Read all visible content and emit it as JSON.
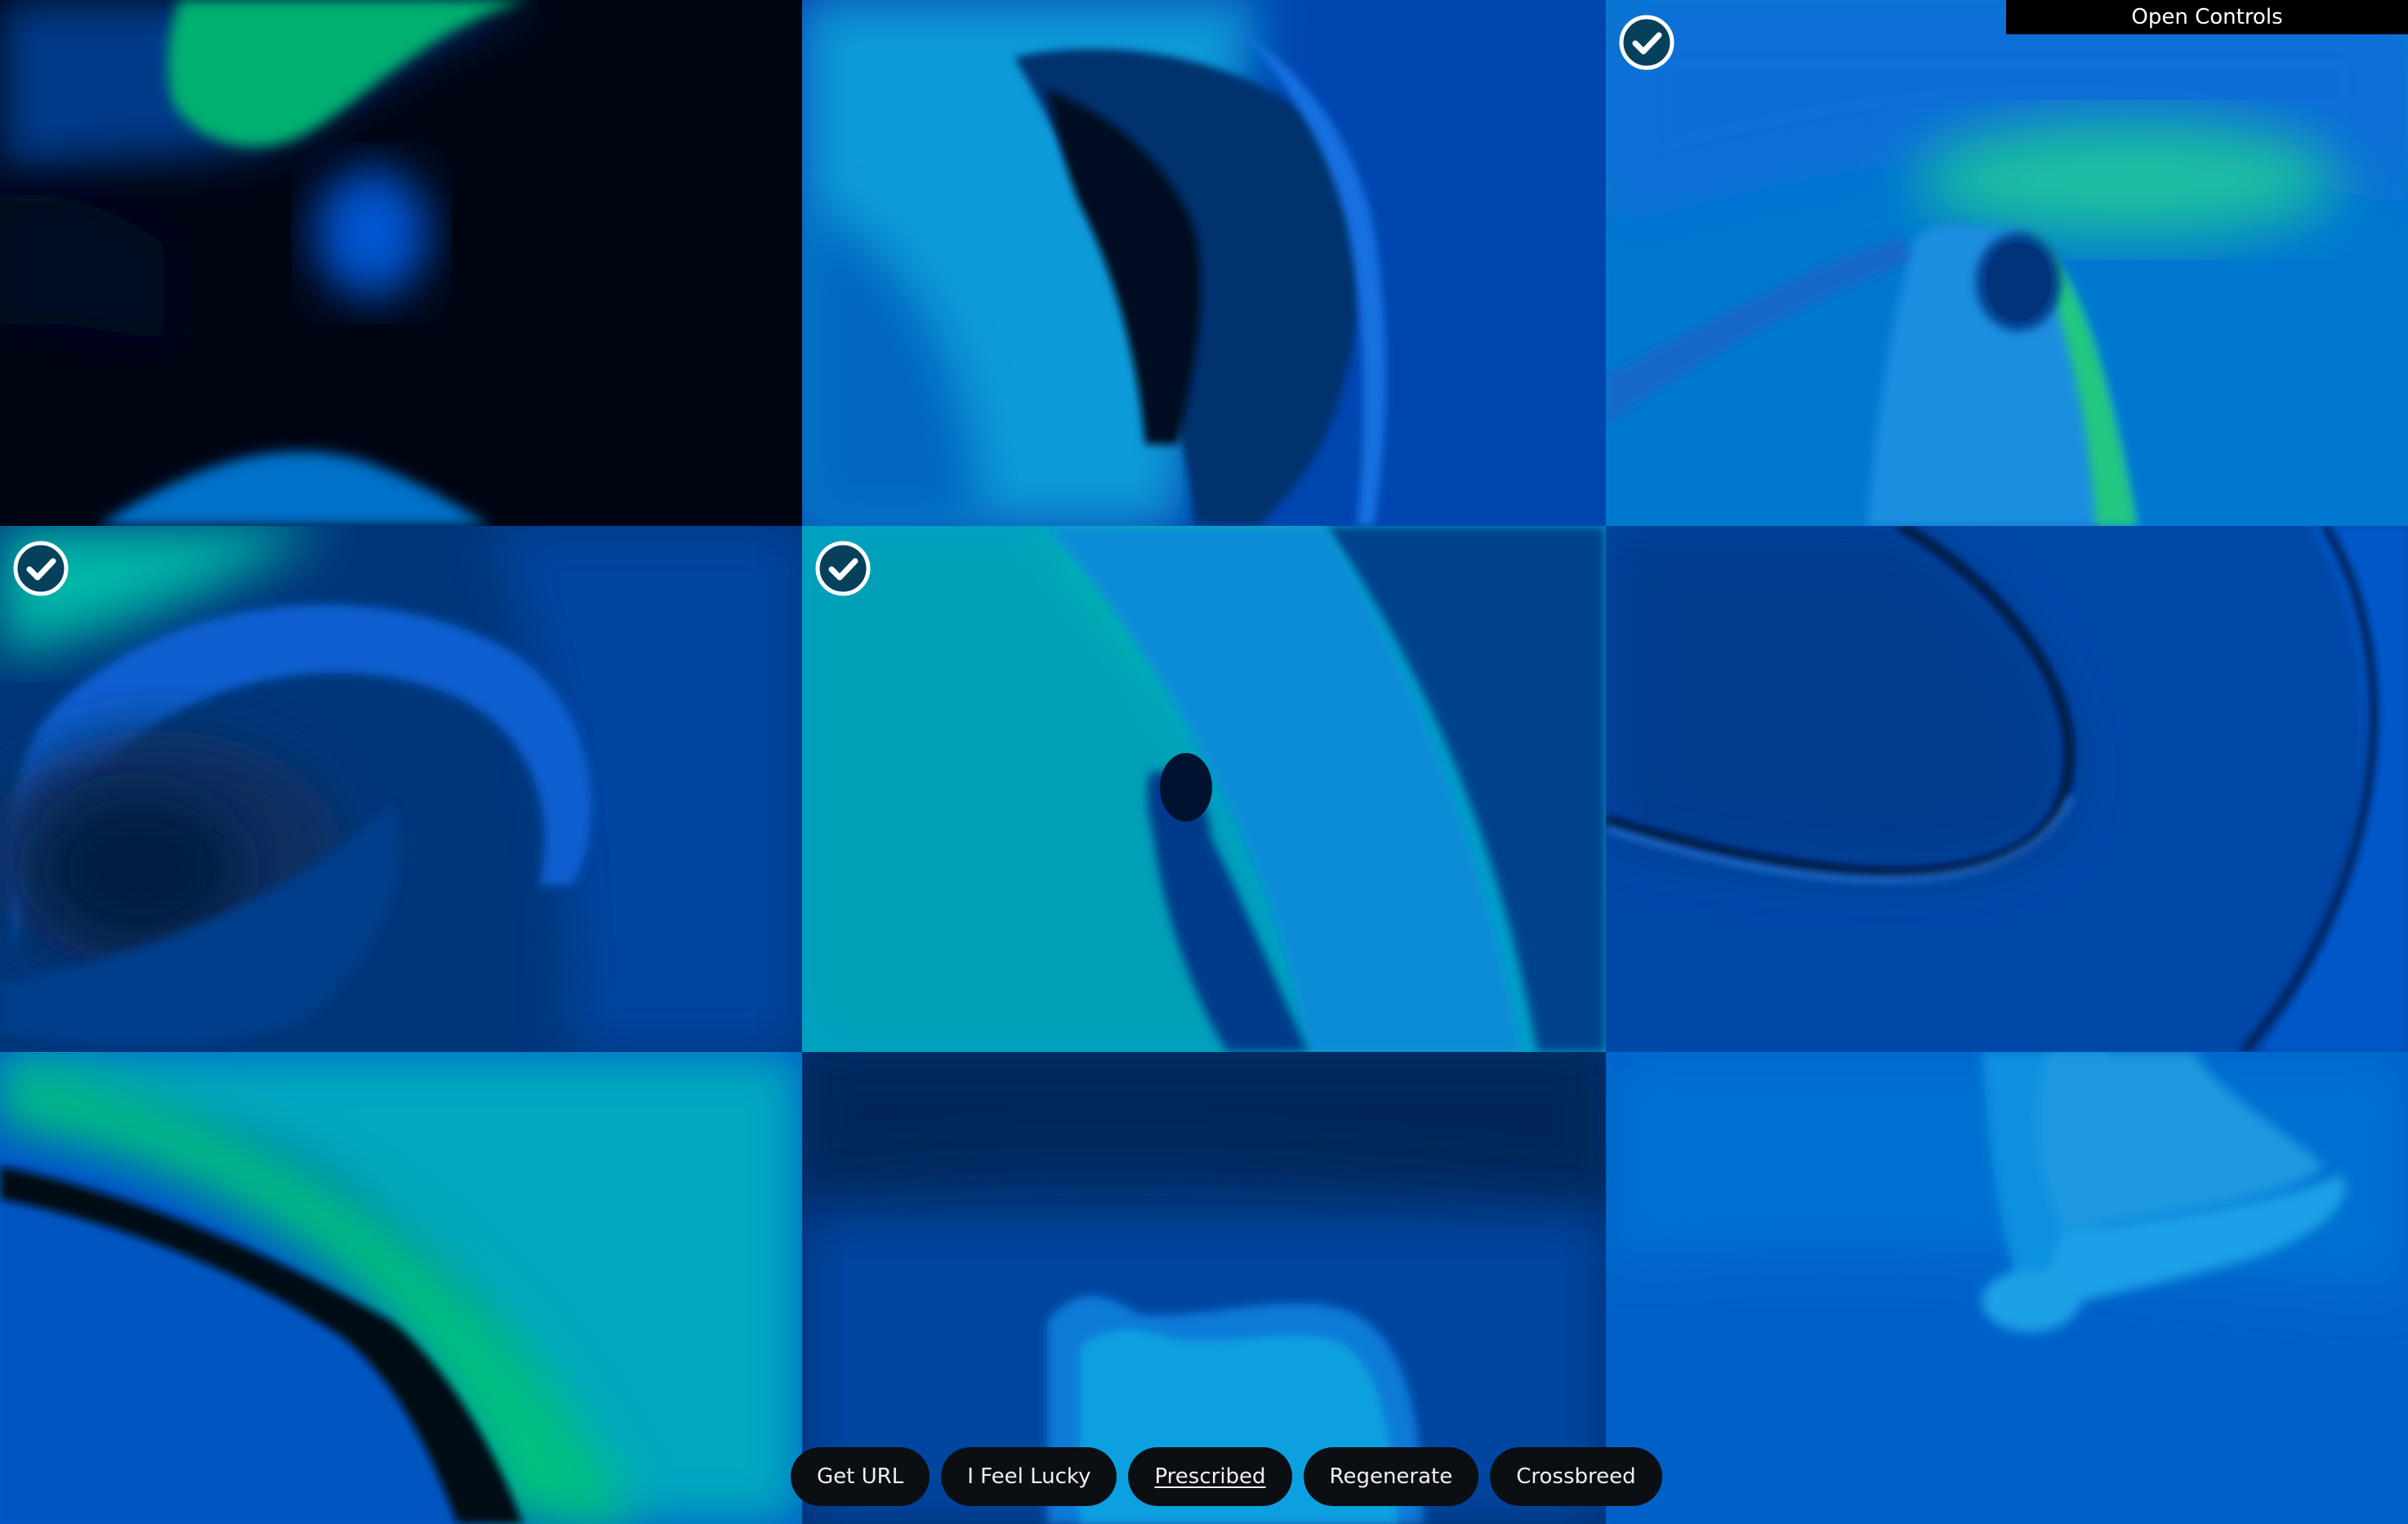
{
  "app": {
    "open_controls_label": "Open Controls",
    "toolbar": [
      {
        "id": "get-url",
        "label": "Get URL",
        "active": false
      },
      {
        "id": "feel-lucky",
        "label": "I Feel Lucky",
        "active": false
      },
      {
        "id": "prescribed",
        "label": "Prescribed",
        "active": true
      },
      {
        "id": "regenerate",
        "label": "Regenerate",
        "active": false
      },
      {
        "id": "crossbreed",
        "label": "Crossbreed",
        "active": false
      }
    ]
  },
  "grid": {
    "rows": 3,
    "columns": 3,
    "tiles": [
      {
        "selected": false
      },
      {
        "selected": false
      },
      {
        "selected": true
      },
      {
        "selected": true
      },
      {
        "selected": true
      },
      {
        "selected": false
      },
      {
        "selected": false
      },
      {
        "selected": false
      },
      {
        "selected": false
      }
    ]
  },
  "colors": {
    "deep_navy": "#00163d",
    "royal_blue": "#0044b8",
    "cyan": "#0099cc",
    "aqua_green": "#00c878",
    "black": "#000000",
    "toolbar_pill": "#0b0f14"
  },
  "icons": {
    "selected_marker": "check-circle-icon"
  }
}
